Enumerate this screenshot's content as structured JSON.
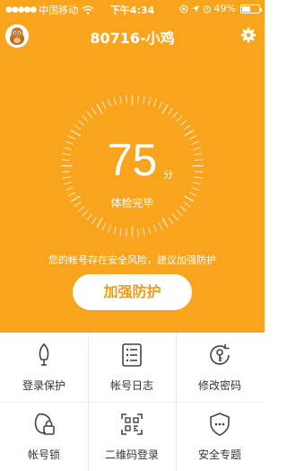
{
  "status_bar": {
    "signal_dots": "●●●●●",
    "carrier": "中国移动",
    "time": "下午4:34",
    "battery": "49%",
    "battery_level": 0.49,
    "icons": [
      "wifi-icon",
      "at-icon",
      "location-icon",
      "alarm-icon"
    ]
  },
  "header": {
    "title": "80716-小鸡",
    "avatar_icon": "chick-avatar",
    "settings_icon": "gear-icon"
  },
  "checkup": {
    "score": "75",
    "score_unit": "分",
    "status": "体检完毕",
    "risk_message": "您的帐号存在安全风险，建议加强防护",
    "boost_button": "加强防护"
  },
  "features": [
    {
      "label": "登录保护",
      "icon": "umbrella-icon"
    },
    {
      "label": "帐号日志",
      "icon": "log-list-icon"
    },
    {
      "label": "修改密码",
      "icon": "key-refresh-icon"
    },
    {
      "label": "帐号锁",
      "icon": "account-lock-icon"
    },
    {
      "label": "二维码登录",
      "icon": "qrcode-icon"
    },
    {
      "label": "安全专题",
      "icon": "shield-dots-icon"
    }
  ],
  "colors": {
    "accent": "#F9A41D",
    "button_text": "#F49A15"
  }
}
